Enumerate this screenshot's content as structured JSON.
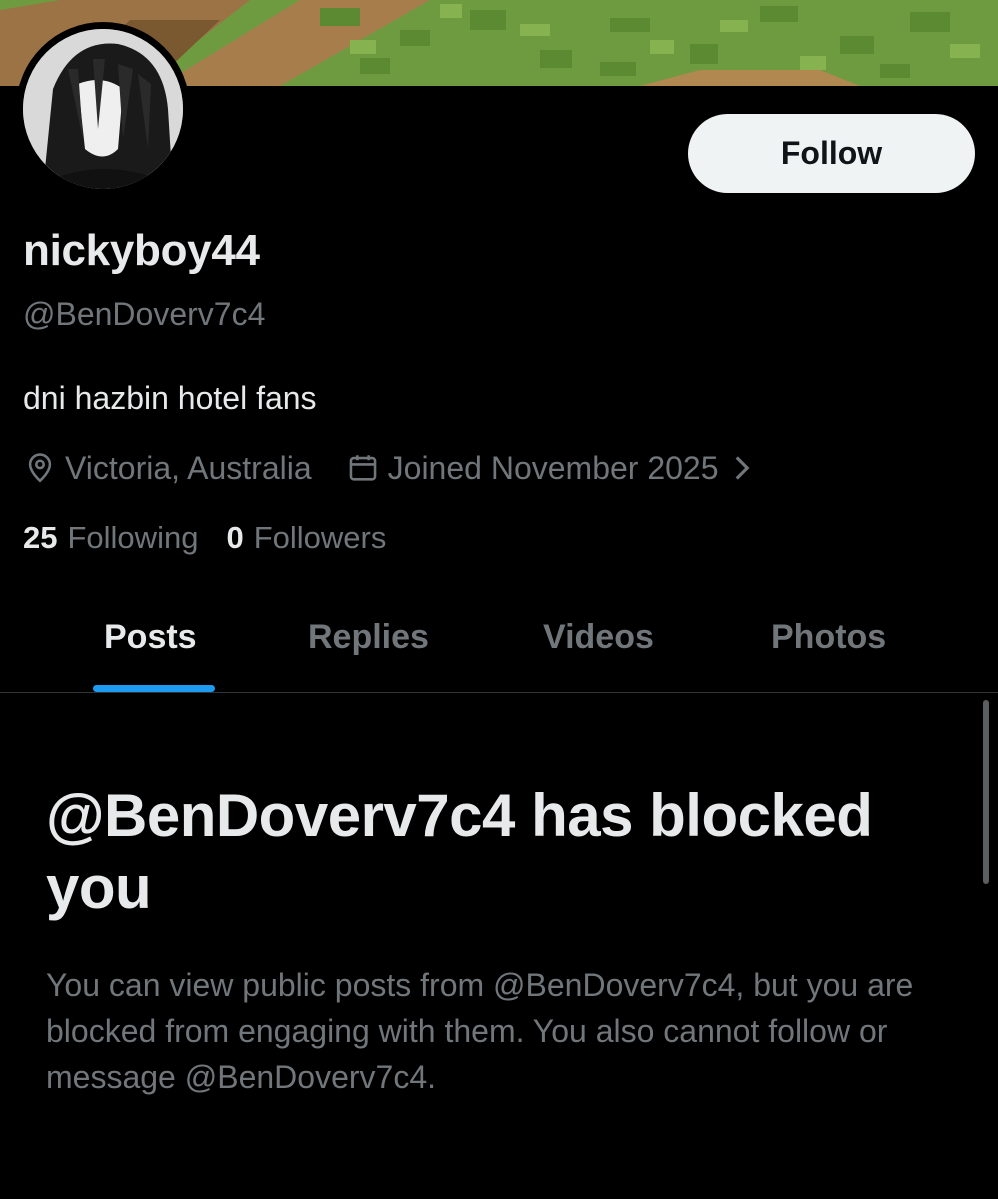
{
  "profile": {
    "display_name": "nickyboy44",
    "handle": "@BenDoverv7c4",
    "bio": "dni hazbin hotel fans",
    "location": "Victoria, Australia",
    "joined": "Joined November 2025",
    "following_count": "25",
    "following_label": "Following",
    "followers_count": "0",
    "followers_label": "Followers"
  },
  "actions": {
    "follow_label": "Follow"
  },
  "tabs": [
    {
      "label": "Posts",
      "active": true
    },
    {
      "label": "Replies",
      "active": false
    },
    {
      "label": "Videos",
      "active": false
    },
    {
      "label": "Photos",
      "active": false
    }
  ],
  "blocked": {
    "title": "@BenDoverv7c4 has blocked you",
    "description": "You can view public posts from @BenDoverv7c4, but you are blocked from engaging with them. You also cannot follow or message @BenDoverv7c4."
  },
  "icons": {
    "location": "map-pin-icon",
    "calendar": "calendar-icon",
    "chevron": "chevron-right-icon"
  },
  "colors": {
    "background": "#000000",
    "text_primary": "#e7e9ea",
    "text_secondary": "#71767b",
    "accent": "#1d9bf0",
    "follow_button_bg": "#eff3f4"
  }
}
